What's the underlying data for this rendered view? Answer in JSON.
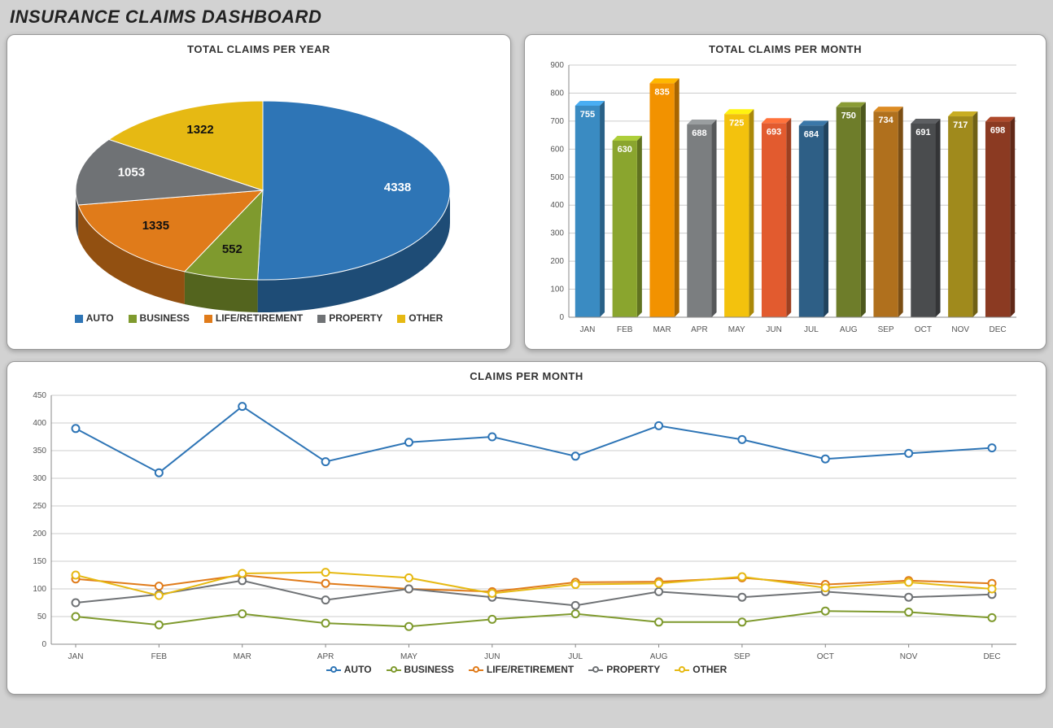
{
  "page_title": "INSURANCE CLAIMS DASHBOARD",
  "colors": {
    "auto": "#2e75b6",
    "business": "#7f9a2e",
    "life": "#e07b1a",
    "property": "#6f7275",
    "other": "#e6b913",
    "bar_jan": "#3a8bc2",
    "bar_feb": "#8aa52e",
    "bar_mar": "#f29200",
    "bar_apr": "#7b7e80",
    "bar_may": "#f3c20d",
    "bar_jun": "#e25b2f",
    "bar_jul": "#2e5f86",
    "bar_aug": "#6e7d2a",
    "bar_sep": "#b0701d",
    "bar_oct": "#4a4c4e",
    "bar_nov": "#a08a1c",
    "bar_dec": "#8b3a22"
  },
  "chart_data": [
    {
      "id": "pie",
      "type": "pie",
      "title": "TOTAL CLAIMS PER YEAR",
      "legend_position": "bottom",
      "slices": [
        {
          "label": "AUTO",
          "value": 4338,
          "color_key": "auto"
        },
        {
          "label": "BUSINESS",
          "value": 552,
          "color_key": "business"
        },
        {
          "label": "LIFE/RETIREMENT",
          "value": 1335,
          "color_key": "life"
        },
        {
          "label": "PROPERTY",
          "value": 1053,
          "color_key": "property"
        },
        {
          "label": "OTHER",
          "value": 1322,
          "color_key": "other"
        }
      ]
    },
    {
      "id": "bar",
      "type": "bar",
      "title": "TOTAL CLAIMS PER MONTH",
      "categories": [
        "JAN",
        "FEB",
        "MAR",
        "APR",
        "MAY",
        "JUN",
        "JUL",
        "AUG",
        "SEP",
        "OCT",
        "NOV",
        "DEC"
      ],
      "values": [
        755,
        630,
        835,
        688,
        725,
        693,
        684,
        750,
        734,
        691,
        717,
        698
      ],
      "bar_color_keys": [
        "bar_jan",
        "bar_feb",
        "bar_mar",
        "bar_apr",
        "bar_may",
        "bar_jun",
        "bar_jul",
        "bar_aug",
        "bar_sep",
        "bar_oct",
        "bar_nov",
        "bar_dec"
      ],
      "ylim": [
        0,
        900
      ],
      "ystep": 100
    },
    {
      "id": "line",
      "type": "line",
      "title": "CLAIMS PER MONTH",
      "categories": [
        "JAN",
        "FEB",
        "MAR",
        "APR",
        "MAY",
        "JUN",
        "JUL",
        "AUG",
        "SEP",
        "OCT",
        "NOV",
        "DEC"
      ],
      "ylim": [
        0,
        450
      ],
      "ystep": 50,
      "legend_position": "bottom",
      "series": [
        {
          "name": "AUTO",
          "color_key": "auto",
          "values": [
            390,
            310,
            430,
            330,
            365,
            375,
            340,
            395,
            370,
            335,
            345,
            355
          ]
        },
        {
          "name": "BUSINESS",
          "color_key": "business",
          "values": [
            50,
            35,
            55,
            38,
            32,
            45,
            55,
            40,
            40,
            60,
            58,
            48
          ]
        },
        {
          "name": "LIFE/RETIREMENT",
          "color_key": "life",
          "values": [
            118,
            105,
            125,
            110,
            100,
            95,
            112,
            113,
            120,
            108,
            115,
            110
          ]
        },
        {
          "name": "PROPERTY",
          "color_key": "property",
          "values": [
            75,
            90,
            115,
            80,
            100,
            85,
            70,
            95,
            85,
            95,
            85,
            90
          ]
        },
        {
          "name": "OTHER",
          "color_key": "other",
          "values": [
            125,
            88,
            128,
            130,
            120,
            92,
            108,
            110,
            122,
            102,
            112,
            100
          ]
        }
      ]
    }
  ]
}
